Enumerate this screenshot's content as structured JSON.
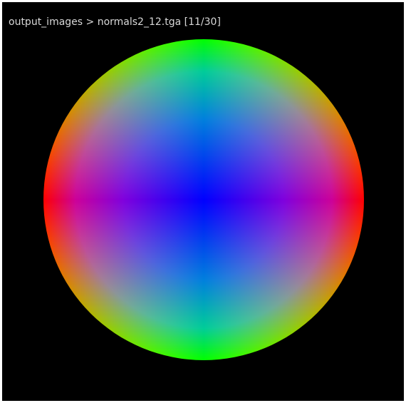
{
  "viewer": {
    "breadcrumb": "output_images > normals2_12.tga [11/30]",
    "image_content": "normal-map-sphere",
    "background_color": "#000000",
    "text_color": "#d8d8d8"
  }
}
